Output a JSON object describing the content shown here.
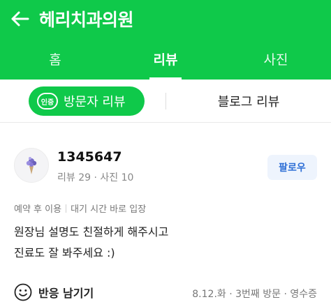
{
  "header": {
    "title": "헤리치과의원"
  },
  "tabs": [
    {
      "label": "홈",
      "active": false
    },
    {
      "label": "리뷰",
      "active": true
    },
    {
      "label": "사진",
      "active": false
    }
  ],
  "subtabs": {
    "visitor": {
      "badge": "인증",
      "label": "방문자 리뷰"
    },
    "blog": {
      "label": "블로그 리뷰"
    }
  },
  "review": {
    "username": "1345647",
    "meta": "리뷰 29 · 사진 10",
    "follow_label": "팔로우",
    "tags": [
      "예약 후 이용",
      "대기 시간 바로 입장"
    ],
    "text_line1": "원장님 설명도 친절하게 해주시고",
    "text_line2": "진료도 잘 봐주세요 :)",
    "react_label": "반응 남기기",
    "visit_info": "8.12.화 · 3번째 방문 · 영수증"
  },
  "colors": {
    "brand_green": "#0fc94a",
    "follow_blue": "#2f6fd6"
  }
}
